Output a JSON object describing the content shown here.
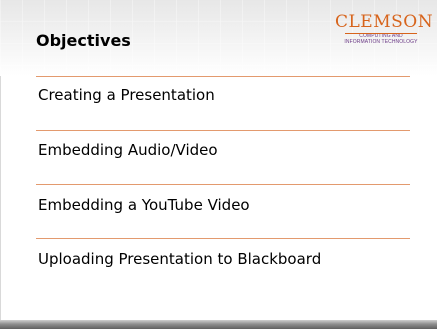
{
  "slide": {
    "title": "Objectives",
    "logo": {
      "word": "CLEMSON",
      "subtitle": "COMPUTING AND\nINFORMATION TECHNOLOGY"
    },
    "items": [
      {
        "label": "Creating a Presentation"
      },
      {
        "label": "Embedding Audio/Video"
      },
      {
        "label": "Embedding a YouTube Video"
      },
      {
        "label": "Uploading Presentation to Blackboard"
      }
    ]
  },
  "colors": {
    "accent_orange": "#d7641c",
    "divider": "#e39a6e",
    "logo_subtitle": "#6b3a86"
  }
}
